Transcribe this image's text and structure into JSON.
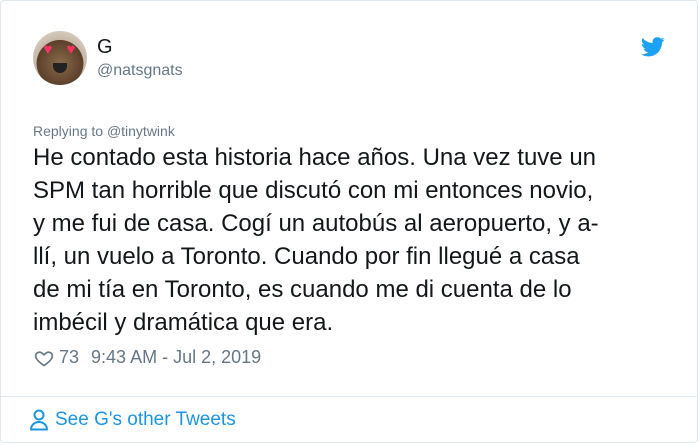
{
  "author": {
    "display_name": "G",
    "handle": "@natsgnats"
  },
  "reply": {
    "prefix": "Replying to ",
    "to": "@tinytwink"
  },
  "tweet_lines": [
    "He contado esta historia hace años. Una vez tuve un",
    "SPM tan horrible que discutó con mi entonces novio,",
    "y me fui de casa. Cogí un autobús al aeropuerto, y a-",
    "llí, un vuelo a Toronto. Cuando por fin llegué a casa",
    "de mi tía en Toronto, es cuando me di cuenta de lo",
    "imbécil y dramática que era."
  ],
  "meta": {
    "likes": "73",
    "timestamp": "9:43 AM - Jul 2, 2019"
  },
  "footer": {
    "label": "See G's other Tweets"
  },
  "colors": {
    "accent": "#1b95e0",
    "muted": "#657786",
    "text": "#14171a"
  },
  "icons": [
    "twitter-bird-icon",
    "heart-icon",
    "person-icon"
  ]
}
